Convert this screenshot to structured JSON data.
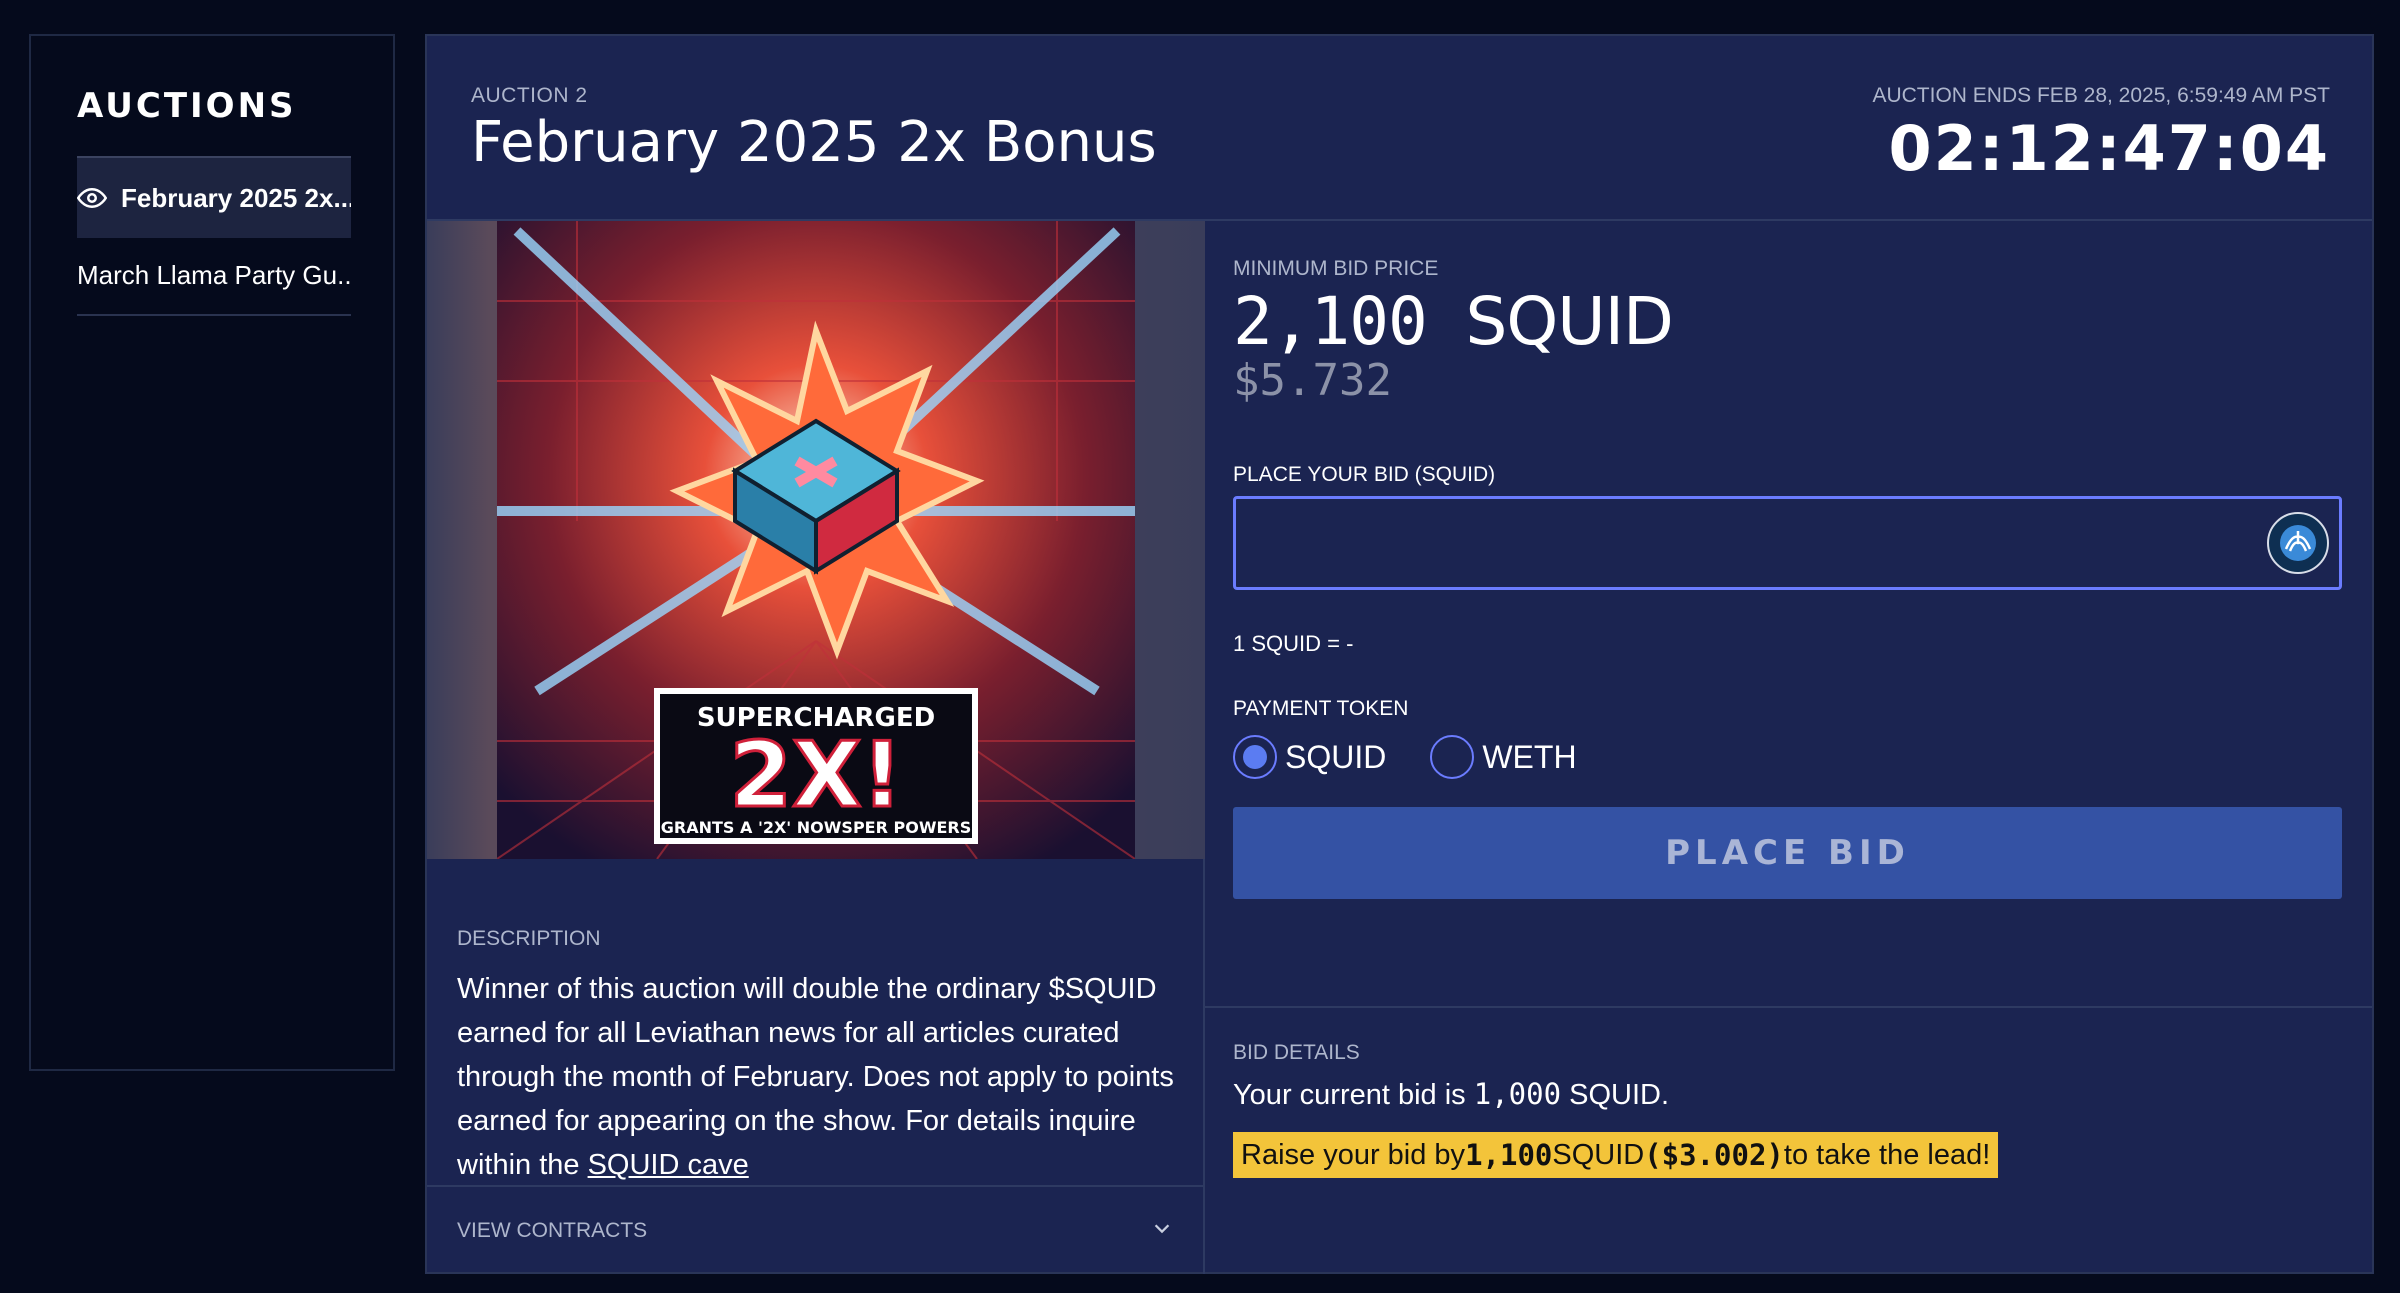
{
  "sidebar": {
    "title": "AUCTIONS",
    "items": [
      {
        "label": "February 2025 2x...",
        "active": true,
        "icon": "eye-icon"
      },
      {
        "label": "March Llama Party Gu...",
        "active": false
      }
    ]
  },
  "header": {
    "auction_number": "AUCTION 2",
    "title": "February 2025 2x Bonus",
    "ends_label": "AUCTION ENDS FEB 28, 2025, 6:59:49 AM PST",
    "countdown": "02:12:47:04"
  },
  "image": {
    "headline": "SUPERCHARGED",
    "big_text": "2X!",
    "caption": "GRANTS A '2X' NOWSPER POWERS"
  },
  "description": {
    "label": "DESCRIPTION",
    "text": "Winner of this auction will double the ordinary $SQUID earned for all Leviathan news for all articles curated through the month of February. Does not apply to points earned for appearing on the show. For details inquire within the ",
    "link_text": "SQUID cave"
  },
  "contracts": {
    "label": "VIEW CONTRACTS",
    "icon": "chevron-down-icon"
  },
  "bid": {
    "min_label": "MINIMUM BID PRICE",
    "min_amount": "2,100",
    "min_unit": "SQUID",
    "min_usd": "$5.732",
    "input_label": "PLACE YOUR BID (SQUID)",
    "input_value": "",
    "input_placeholder": "",
    "rate": "1 SQUID = -",
    "payment_label": "PAYMENT TOKEN",
    "tokens": [
      {
        "label": "SQUID",
        "selected": true
      },
      {
        "label": "WETH",
        "selected": false
      }
    ],
    "button_label": "PLACE BID"
  },
  "bid_details": {
    "label": "BID DETAILS",
    "current_prefix": "Your current bid is ",
    "current_amount": "1,000",
    "current_suffix": " SQUID.",
    "raise_prefix": "Raise your bid by ",
    "raise_amount": "1,100",
    "raise_unit": " SQUID ",
    "raise_usd": "($3.002)",
    "raise_suffix": " to take the lead!"
  },
  "colors": {
    "background": "#050a1c",
    "panel": "#1b2451",
    "accent": "#5b7cf2",
    "button": "#3452a4",
    "highlight": "#f3c43a"
  }
}
